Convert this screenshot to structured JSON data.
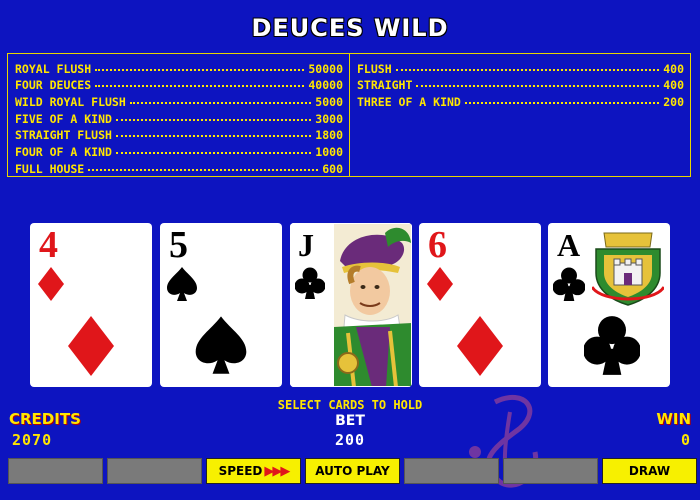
{
  "title": "DEUCES WILD",
  "paytable": {
    "left": [
      {
        "hand": "ROYAL FLUSH",
        "payout": "50000"
      },
      {
        "hand": "FOUR DEUCES",
        "payout": "40000"
      },
      {
        "hand": "WILD ROYAL FLUSH",
        "payout": "5000"
      },
      {
        "hand": "FIVE OF A KIND",
        "payout": "3000"
      },
      {
        "hand": "STRAIGHT FLUSH",
        "payout": "1800"
      },
      {
        "hand": "FOUR OF A KIND",
        "payout": "1000"
      },
      {
        "hand": "FULL HOUSE",
        "payout": "600"
      }
    ],
    "right": [
      {
        "hand": "FLUSH",
        "payout": "400"
      },
      {
        "hand": "STRAIGHT",
        "payout": "400"
      },
      {
        "hand": "THREE OF A KIND",
        "payout": "200"
      }
    ]
  },
  "cards": [
    {
      "rank": "4",
      "suit": "diamond",
      "color": "red"
    },
    {
      "rank": "5",
      "suit": "spade",
      "color": "black"
    },
    {
      "rank": "J",
      "suit": "club",
      "color": "black"
    },
    {
      "rank": "6",
      "suit": "diamond",
      "color": "red"
    },
    {
      "rank": "A",
      "suit": "club",
      "color": "black"
    }
  ],
  "status_text": "SELECT CARDS TO HOLD",
  "bet": {
    "label": "BET",
    "value": "200"
  },
  "credits": {
    "label": "CREDITS",
    "value": "2070"
  },
  "win": {
    "label": "WIN",
    "value": "0"
  },
  "buttons": {
    "hold1": "",
    "hold2": "",
    "speed": "SPEED",
    "autoplay": "AUTO PLAY",
    "hold4": "",
    "hold5": "",
    "draw": "DRAW"
  },
  "colors": {
    "background": "#0d14c0",
    "paytable_text": "#ffe600",
    "button_active": "#f7f000",
    "button_inactive": "#7a7a7a",
    "card_red": "#e0161a"
  },
  "icons": [
    "diamond-icon",
    "spade-icon",
    "club-icon",
    "speed-arrows-icon"
  ]
}
